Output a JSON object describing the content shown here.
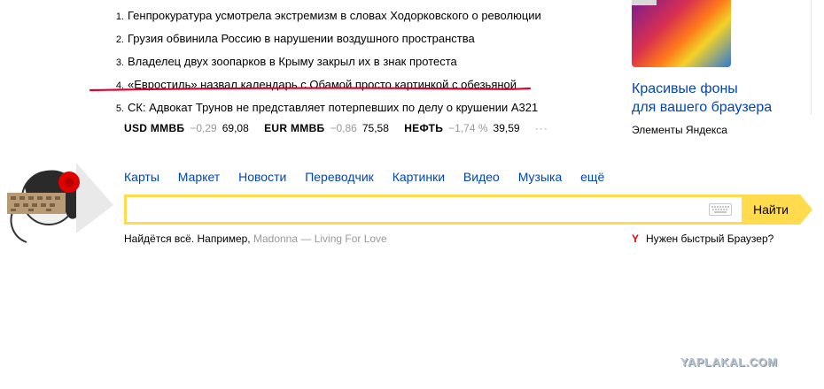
{
  "news": [
    {
      "num": "1.",
      "text": "Генпрокуратура усмотрела экстремизм в словах Ходорковского о революции"
    },
    {
      "num": "2.",
      "text": "Грузия обвинила Россию в нарушении воздушного пространства"
    },
    {
      "num": "3.",
      "text": "Владелец двух зоопарков в Крыму закрыл их в знак протеста"
    },
    {
      "num": "4.",
      "text": "«Евростиль» назвал календарь с Обамой просто картинкой с обезьяной"
    },
    {
      "num": "5.",
      "text": "СК: Адвокат Трунов не представляет потерпевших по делу о крушении А321"
    }
  ],
  "quotes": [
    {
      "name": "USD ММВБ",
      "change": "−0,29",
      "value": "69,08"
    },
    {
      "name": "EUR ММВБ",
      "change": "−0,86",
      "value": "75,58"
    },
    {
      "name": "НЕФТЬ",
      "change": "−1,74 %",
      "value": "39,59"
    }
  ],
  "quotes_more": "···",
  "promo": {
    "title_line1": "Красивые фоны",
    "title_line2": "для вашего браузера",
    "subtitle": "Элементы Яндекса"
  },
  "services": [
    "Карты",
    "Маркет",
    "Новости",
    "Переводчик",
    "Картинки",
    "Видео",
    "Музыка",
    "ещё"
  ],
  "search": {
    "value": "",
    "placeholder": "",
    "button_label": "Найти"
  },
  "example": {
    "prefix": "Найдётся всё. Например,",
    "link": "Madonna — Living For Love"
  },
  "browser_promo": {
    "icon": "Y",
    "text": "Нужен быстрый Браузер?"
  },
  "watermark": "YAPLAKAL.COM",
  "colors": {
    "link": "#0044bb",
    "search_accent": "#ffdb4d",
    "annotation_red": "#e0002a"
  }
}
